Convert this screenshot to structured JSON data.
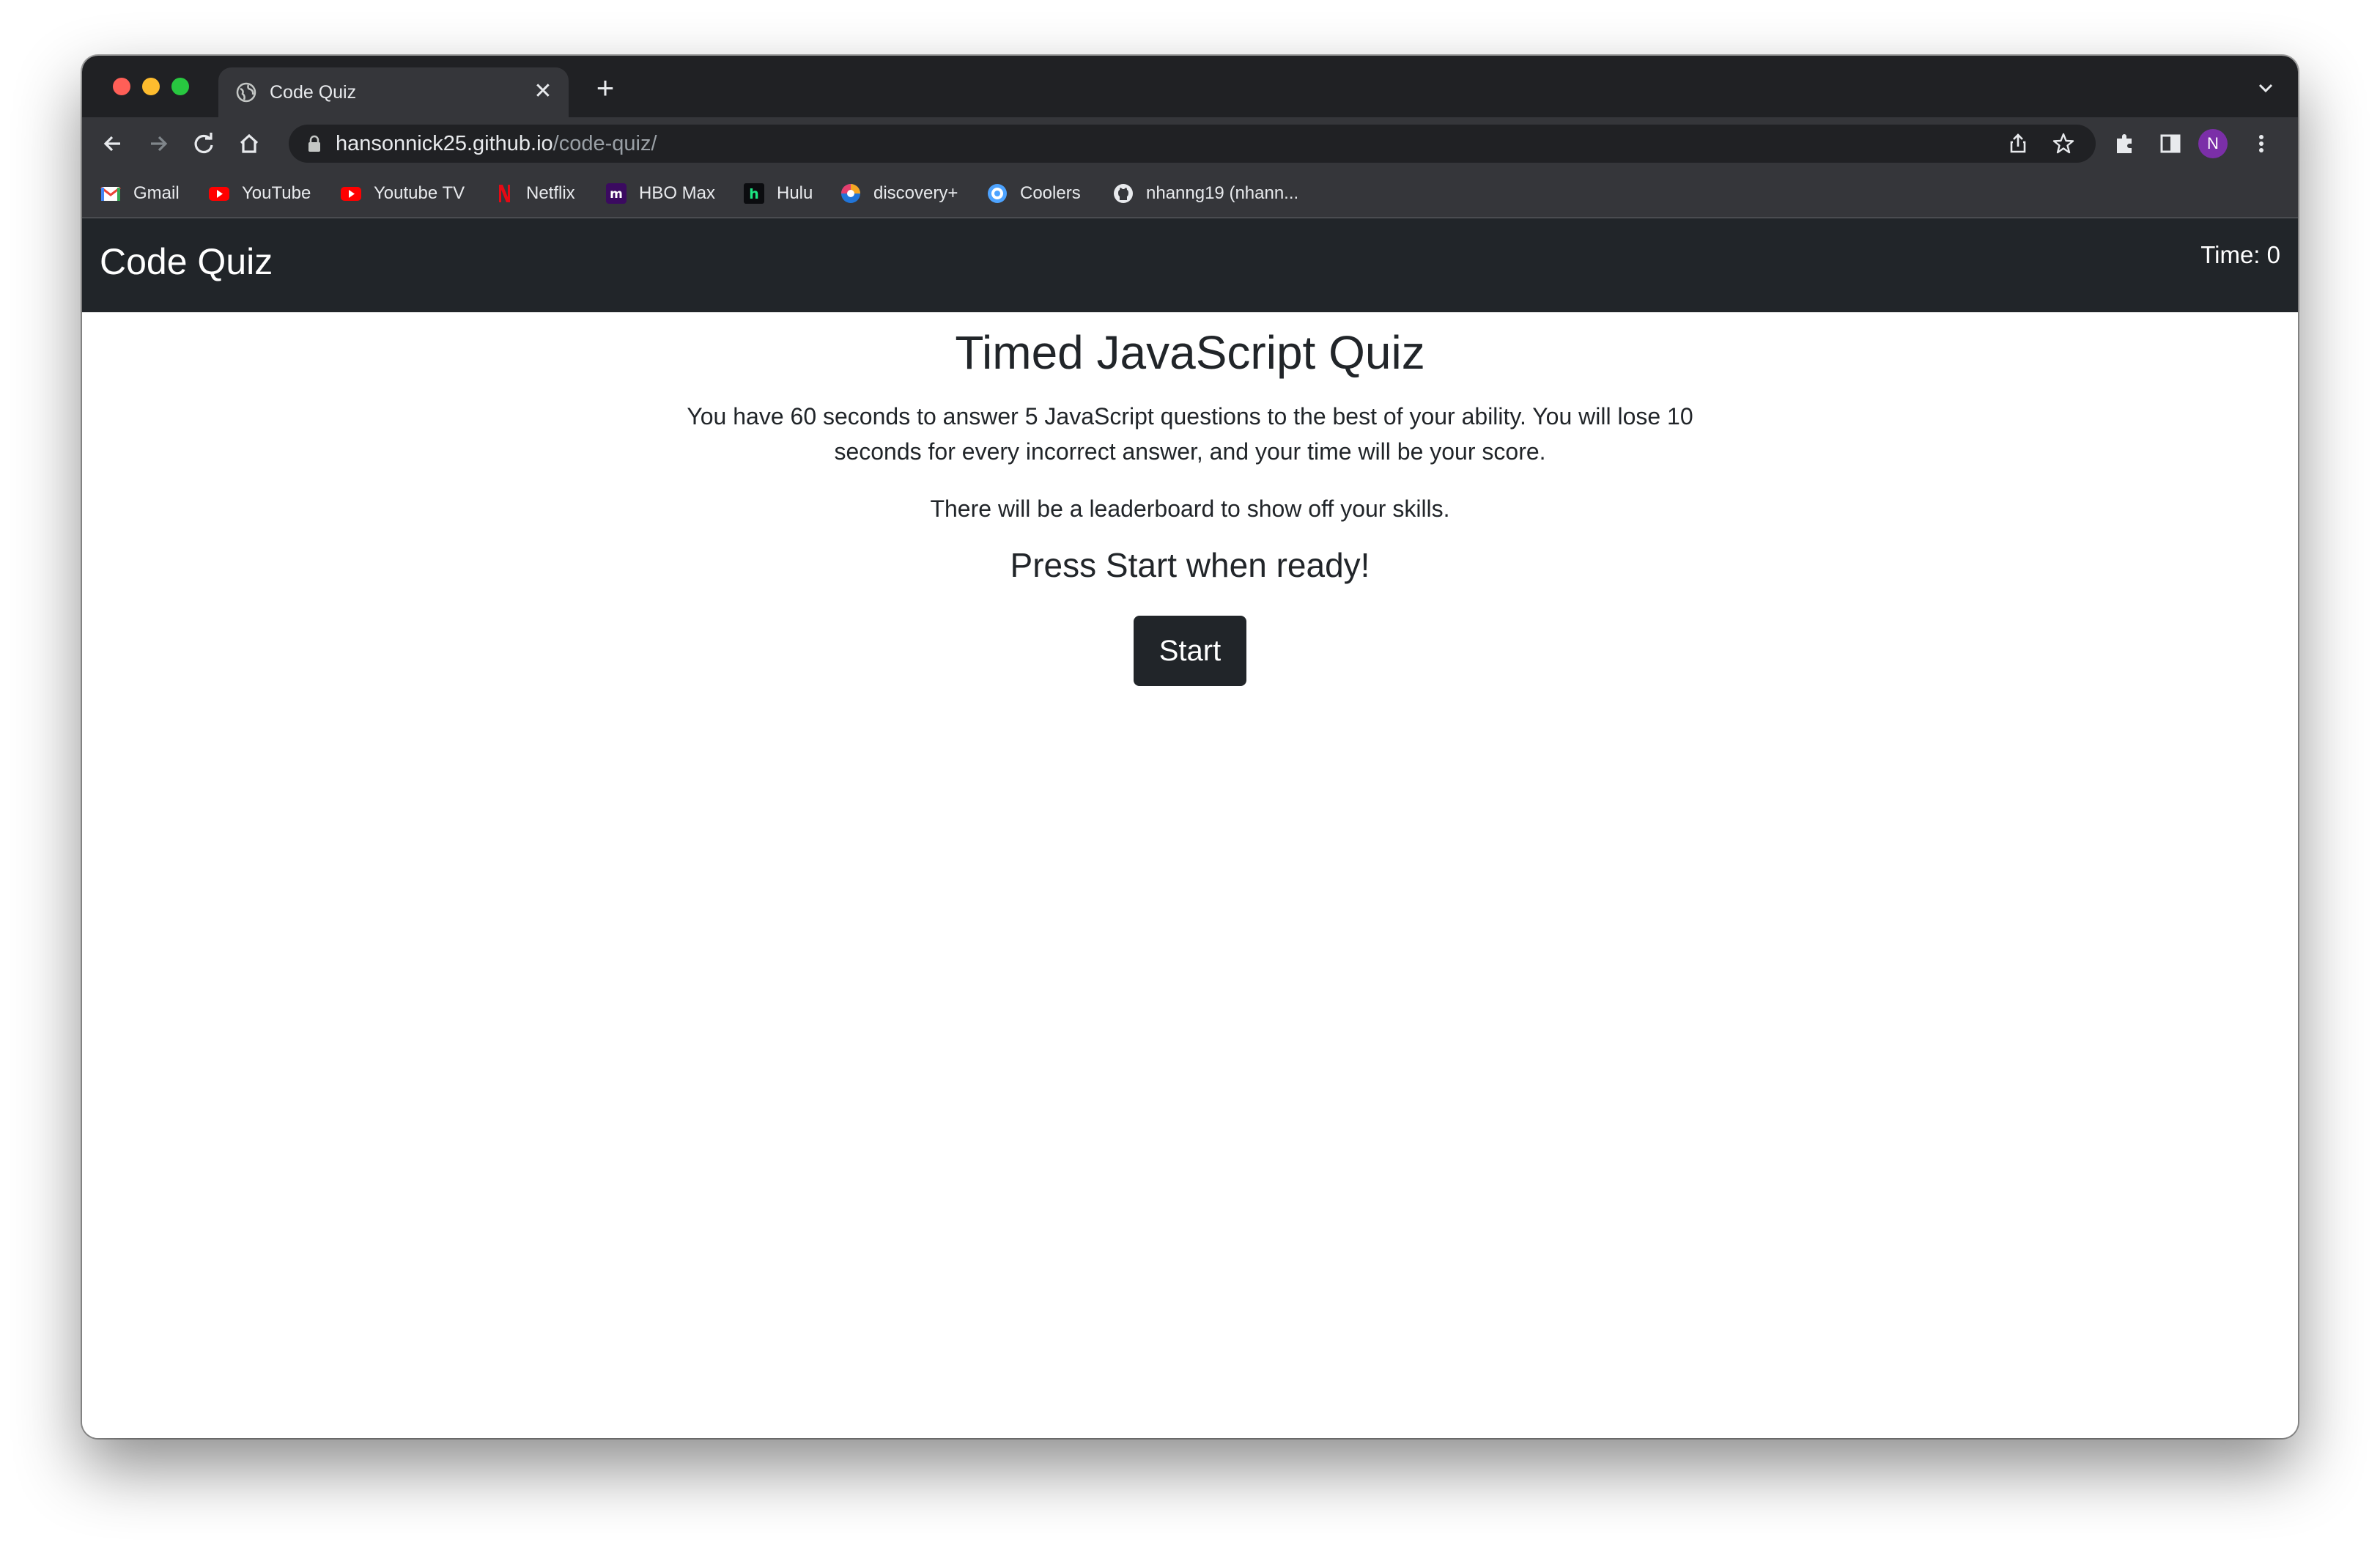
{
  "browser": {
    "tab": {
      "title": "Code Quiz"
    },
    "url": {
      "domain": "hansonnick25.github.io",
      "path": "/code-quiz/"
    },
    "profile_initial": "N",
    "bookmarks": [
      {
        "label": "Gmail",
        "icon": "gmail-icon"
      },
      {
        "label": "YouTube",
        "icon": "youtube-icon"
      },
      {
        "label": "Youtube TV",
        "icon": "youtube-tv-icon"
      },
      {
        "label": "Netflix",
        "icon": "netflix-icon"
      },
      {
        "label": "HBO Max",
        "icon": "hbo-max-icon"
      },
      {
        "label": "Hulu",
        "icon": "hulu-icon"
      },
      {
        "label": "discovery+",
        "icon": "discovery-plus-icon"
      },
      {
        "label": "Coolers",
        "icon": "coolers-icon"
      },
      {
        "label": "nhanng19 (nhann...",
        "icon": "github-icon"
      }
    ]
  },
  "app": {
    "brand": "Code Quiz",
    "timer": {
      "label": "Time:",
      "value": "0"
    },
    "heading": "Timed JavaScript Quiz",
    "intro": "You have 60 seconds to answer 5 JavaScript questions to the best of your ability. You will lose 10 seconds for every incorrect answer, and your time will be your score.",
    "leaderboard_note": "There will be a leaderboard to show off your skills.",
    "ready_prompt": "Press Start when ready!",
    "start_label": "Start"
  },
  "colors": {
    "navbar": "#212529",
    "button": "#212529",
    "browser_frame": "#202124",
    "browser_toolbar": "#35363a",
    "avatar": "#7b2fa8"
  }
}
